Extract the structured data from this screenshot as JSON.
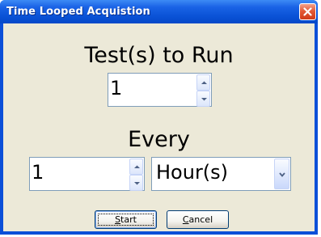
{
  "window": {
    "title": "Time Looped Acquistion",
    "close_icon": "close-icon"
  },
  "tests": {
    "label": "Test(s) to Run",
    "value": "1"
  },
  "interval": {
    "label": "Every",
    "value": "1",
    "unit": "Hour(s)"
  },
  "buttons": {
    "start": {
      "first": "S",
      "rest": "tart"
    },
    "cancel": {
      "first": "C",
      "rest": "ancel"
    }
  },
  "colors": {
    "titlebar": "#0a52d6",
    "client": "#ece9d8",
    "close": "#e35a36"
  }
}
